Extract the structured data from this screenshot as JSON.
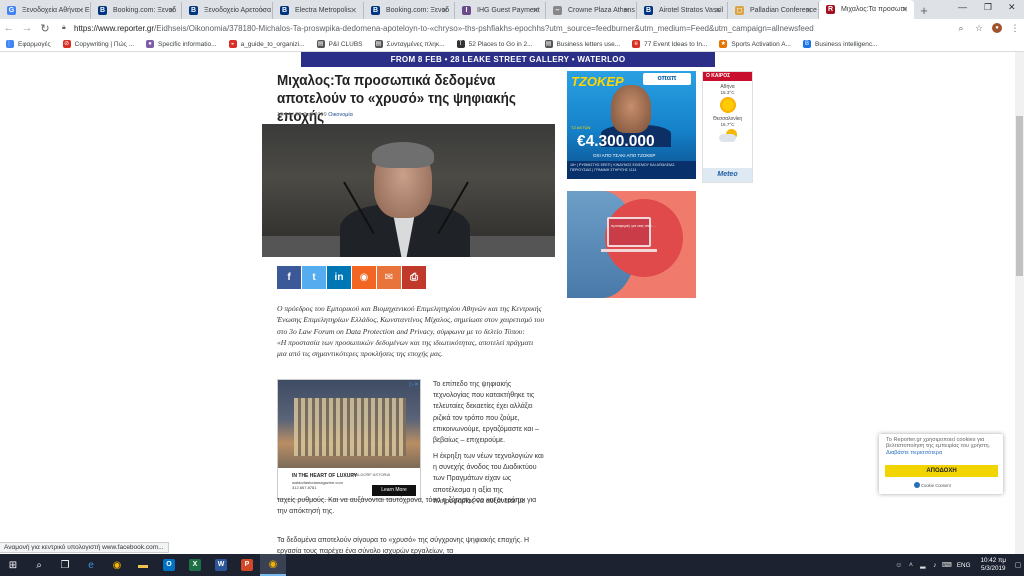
{
  "tabs": [
    {
      "title": "Ξενοδοχεία Αθήνα - Ε",
      "icon": "G",
      "color": "#4285f4"
    },
    {
      "title": "Booking.com: Ξενοδ",
      "icon": "B",
      "color": "#003580"
    },
    {
      "title": "Ξενοδοχείο Αρετούσα",
      "icon": "B",
      "color": "#003580"
    },
    {
      "title": "Electra Metropolis",
      "icon": "B",
      "color": "#003580"
    },
    {
      "title": "Booking.com: Ξενοδ",
      "icon": "B",
      "color": "#003580"
    },
    {
      "title": "IHG Guest Payment",
      "icon": "I",
      "color": "#6b4b8c"
    },
    {
      "title": "Crowne Plaza Athens",
      "icon": "–",
      "color": "#888888"
    },
    {
      "title": "Airotel Stratos Vassil",
      "icon": "B",
      "color": "#003580"
    },
    {
      "title": "Palladian Conference",
      "icon": "◻",
      "color": "#d9a441"
    },
    {
      "title": "Μιχαλος:Τα προσωπι",
      "icon": "R",
      "color": "#a10f1f",
      "active": true
    }
  ],
  "address": {
    "url_domain": "https://www.reporter.gr",
    "url_path": "/Eidhseis/Oikonomia/378180-Michalos-Ta-proswpika-dedomena-apoteloyn-to-«chryso»-ths-pshfiakhs-epochhs?utm_source=feedburner&utm_medium=Feed&utm_campaign=allnewsfeed"
  },
  "bookmarks": [
    {
      "label": "Εφαρμογές",
      "icon": "⋮⋮",
      "color": "#4285f4"
    },
    {
      "label": "Copywriting | Πώς ...",
      "icon": "⊘",
      "color": "#d93025"
    },
    {
      "label": "Specific informatio...",
      "icon": "●",
      "color": "#7b5ea7"
    },
    {
      "label": "a_guide_to_organizi...",
      "icon": "◒",
      "color": "#d93025"
    },
    {
      "label": "P&I CLUBS",
      "icon": "▤",
      "color": "#555555"
    },
    {
      "label": "Συνταγμένες πληκ...",
      "icon": "▤",
      "color": "#555555"
    },
    {
      "label": "52 Places to Go in 2...",
      "icon": "T",
      "color": "#333333"
    },
    {
      "label": "Business letters use...",
      "icon": "▤",
      "color": "#555555"
    },
    {
      "label": "77 Event Ideas to In...",
      "icon": "e",
      "color": "#d93025"
    },
    {
      "label": "Sports Activation A...",
      "icon": "★",
      "color": "#e37400"
    },
    {
      "label": "Business intelligenc...",
      "icon": "B",
      "color": "#1a73e8"
    }
  ],
  "banner": "FROM 8 FEB • 28 LEAKE STREET GALLERY • WATERLOO",
  "article": {
    "title": "Μιχαλος:Τα προσωπικά δεδομένα αποτελούν το «χρυσό» της ψηφιακής εποχής",
    "meta_date": "10:54 | 22 Φεβ 2019",
    "meta_cat": "Οικονομία",
    "lead": "Ο πρόεδρος του Εμπορικού και Βιομηχανικού Επιμελητηρίου Αθηνών και της Κεντρικής Ένωσης Επιμελητηρίων Ελλάδος, Κωνσταντίνος Μίχαλος, σημείωσε στον χαιρετισμό του στο 3ο Law Forum on Data Protection and Privacy, σύμφωνα με το δελτίο Τύπου:",
    "quote": "«Η προστασία των προσωπικών δεδομένων και της ιδιωτικότητας, αποτελεί πράγματι μια από τις σημαντικότερες προκλήσεις της εποχής μας.",
    "p1": "Το επίπεδο της ψηφιακής τεχνολογίας που κατακτήθηκε τις τελευταίες δεκαετίες έχει αλλάξει ριζικά τον τρόπο που ζούμε, επικοινωνούμε, εργαζόμαστε και – βεβαίως – επιχειρούμε.",
    "p2a": "Η έκρηξη των νέων τεχνολογιών και η συνεχής άνοδος του Διαδικτύου των Πραγμάτων είχαν ως αποτέλεσμα η αξία της πληροφορίας να αυξάνεται με",
    "p2b": "ταχείς ρυθμούς. Και να αυξάνονται ταυτόχρονα, τόσο η ζήτηση όσο και οι τρόποι για την απόκτησή της.",
    "p3": "Τα δεδομένα αποτελούν σίγουρα το «χρυσό» της σύγχρονης ψηφιακής εποχής. Η εργασία τους παρέχει ένα σύνολο ισχυρών εργαλείων, τα"
  },
  "share_buttons": [
    {
      "name": "facebook",
      "glyph": "f",
      "color": "#3b5998"
    },
    {
      "name": "twitter",
      "glyph": "t",
      "color": "#55acee"
    },
    {
      "name": "linkedin",
      "glyph": "in",
      "color": "#0077b5"
    },
    {
      "name": "rss",
      "glyph": "◉",
      "color": "#f26522"
    },
    {
      "name": "email",
      "glyph": "✉",
      "color": "#e8743b"
    },
    {
      "name": "print",
      "glyph": "⎙",
      "color": "#c0392b"
    }
  ],
  "hotel_ad": {
    "headline": "IN THE HEART OF LUXURY",
    "site": "waldorfastoriamagazine.com",
    "phone": "312.667.8781",
    "brand": "WALDORF ASTORIA",
    "cta": "Learn More"
  },
  "tzoker_ad": {
    "logo": "ΤΖΟΚΕΡ",
    "brand": "οπαπ",
    "amount": "€4.300.000",
    "sub": "ΟΧΙ ΑΠΟ ΤΣΑΚΙ ΑΠΟ ΤΖΟΚΕΡ",
    "tag": "ΤΖ ΑΚΤΩΝ",
    "fine": "18+ | ΡΥΘΜΙΣΤΗΣ ΕΕΕΠ | ΚΙΝΔΥΝΟΣ ΕΘΙΣΜΟΥ ΚΑΙ ΑΠΩΛΕΙΑΣ ΠΕΡΙΟΥΣΙΑΣ | ΓΡΑΜΜΗ ΣΤΗΡΙΞΗΣ 1114"
  },
  "weather": {
    "header": "Ο ΚΑΙΡΟΣ",
    "cities": [
      {
        "name": "Αθήνα",
        "temp": "15.3°C",
        "icon": "sun-icon"
      },
      {
        "name": "Θεσσαλονίκη",
        "temp": "16.7°C",
        "icon": "partly-cloudy-icon"
      }
    ],
    "brand": "Meteo"
  },
  "laptop_ad": {
    "screen_text": "προσφορές για σας από ..."
  },
  "cookie": {
    "text": "Το Reporter.gr χρησιμοποιεί cookies για βελτιστοποίηση της εμπειρίας του χρήστη.",
    "link": "Διαβάστε περισσότερα",
    "accept": "ΑΠΟΔΟΧΗ",
    "consent": "Cookie Consent"
  },
  "status_bar": "Αναμονή για κεντρικό υπολογιστή www.facebook.com...",
  "taskbar": {
    "apps": [
      {
        "name": "start",
        "glyph": "⊞",
        "color": "#ffffff"
      },
      {
        "name": "search",
        "glyph": "⌕",
        "color": "#ffffff"
      },
      {
        "name": "task-view",
        "glyph": "❐",
        "color": "#ffffff"
      },
      {
        "name": "edge",
        "glyph": "e",
        "color": "#3a96dd"
      },
      {
        "name": "chrome",
        "glyph": "◉",
        "color": "#f4b400"
      },
      {
        "name": "explorer",
        "glyph": "▬",
        "color": "#f2c14e"
      },
      {
        "name": "outlook",
        "glyph": "O",
        "color": "#0072c6"
      },
      {
        "name": "excel",
        "glyph": "X",
        "color": "#1e7145"
      },
      {
        "name": "word",
        "glyph": "W",
        "color": "#2b579a"
      },
      {
        "name": "powerpoint",
        "glyph": "P",
        "color": "#d24726"
      },
      {
        "name": "chrome-active",
        "glyph": "◉",
        "color": "#f4b400",
        "active": true
      }
    ],
    "lang": "ENG",
    "time": "10:42 πμ",
    "date": "5/3/2019"
  }
}
